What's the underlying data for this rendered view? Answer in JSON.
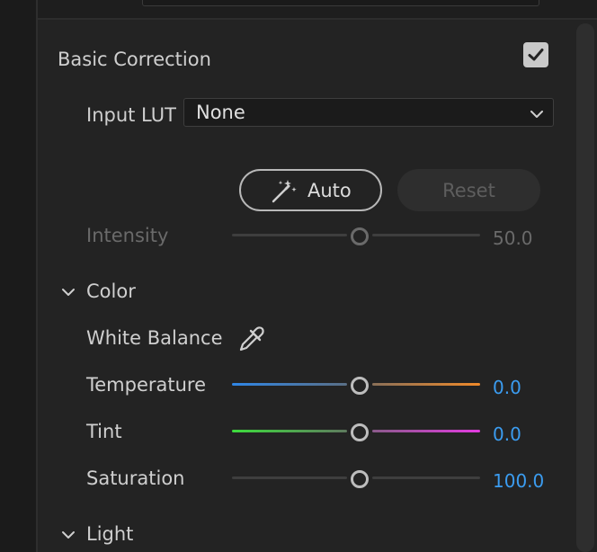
{
  "panel": {
    "title": "Basic Correction",
    "enabled": true
  },
  "input_lut": {
    "label": "Input LUT",
    "value": "None"
  },
  "buttons": {
    "auto_label": "Auto",
    "reset_label": "Reset"
  },
  "intensity": {
    "label": "Intensity",
    "value": "50.0",
    "position": 0.5
  },
  "color_section": {
    "label": "Color",
    "white_balance_label": "White Balance",
    "temperature": {
      "label": "Temperature",
      "value": "0.0",
      "position": 0.5
    },
    "tint": {
      "label": "Tint",
      "value": "0.0",
      "position": 0.5
    },
    "saturation": {
      "label": "Saturation",
      "value": "100.0",
      "position": 0.5
    }
  },
  "light_section": {
    "label": "Light"
  },
  "colors": {
    "value_blue": "#3b9cf0",
    "temperature_cool": "#2f86e6",
    "temperature_warm": "#f08a2a",
    "tint_green": "#3ddc3d",
    "tint_magenta": "#e23be0"
  },
  "icons": {
    "checkbox": "checkmark-icon",
    "dropdown": "chevron-down-icon",
    "auto": "magic-wand-icon",
    "white_balance": "eyedropper-icon",
    "section_toggle": "chevron-down-icon"
  }
}
